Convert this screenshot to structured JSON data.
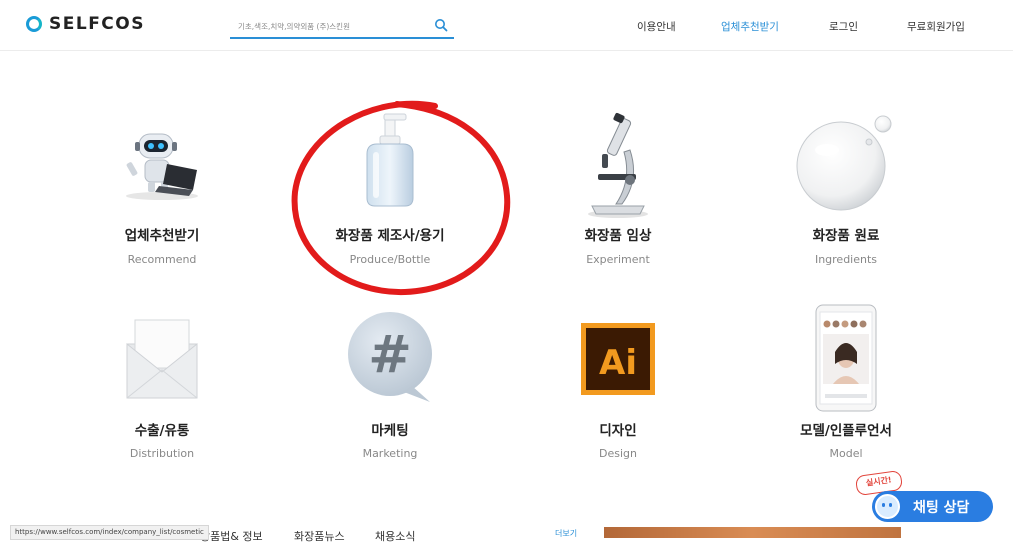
{
  "header": {
    "logo_text": "SELFCOS",
    "search_placeholder": "기초,색조,치약,의약외품 (주)스킨원",
    "nav": [
      "이용안내",
      "업체추천받기",
      "로그인",
      "무료회원가입"
    ],
    "active_nav_index": 1
  },
  "categories": [
    {
      "ko": "업체추천받기",
      "en": "Recommend",
      "icon": "robot-laptop-icon"
    },
    {
      "ko": "화장품 제조사/용기",
      "en": "Produce/Bottle",
      "icon": "pump-bottle-icon"
    },
    {
      "ko": "화장품 임상",
      "en": "Experiment",
      "icon": "microscope-icon"
    },
    {
      "ko": "화장품 원료",
      "en": "Ingredients",
      "icon": "water-drop-icon"
    },
    {
      "ko": "수출/유통",
      "en": "Distribution",
      "icon": "envelope-icon"
    },
    {
      "ko": "마케팅",
      "en": "Marketing",
      "icon": "hashtag-bubble-icon"
    },
    {
      "ko": "디자인",
      "en": "Design",
      "icon": "illustrator-icon"
    },
    {
      "ko": "모델/인플루언서",
      "en": "Model",
      "icon": "phone-profile-icon"
    }
  ],
  "design_icon_text": "Ai",
  "hashtag_symbol": "#",
  "bottom": {
    "status_url": "https://www.selfcos.com/index/company_list/cosmetic",
    "peek_tabs": [
      "장품법& 정보",
      "화장품뉴스",
      "채용소식"
    ],
    "more_link": "더보기"
  },
  "chat": {
    "label": "채팅 상담",
    "badge": "실시간!"
  },
  "colors": {
    "accent": "#2a8fd6",
    "chat": "#2a7de1",
    "highlight_red": "#e21b1b"
  }
}
